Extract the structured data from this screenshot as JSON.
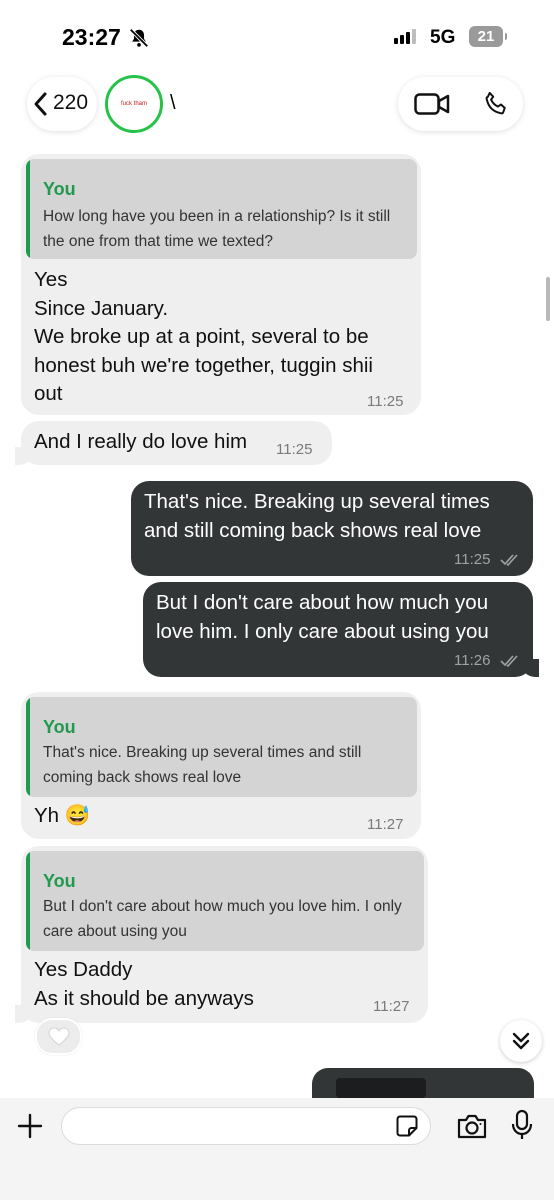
{
  "status_bar": {
    "time": "23:27",
    "network": "5G",
    "battery": "21"
  },
  "header": {
    "back_count": "220",
    "avatar_text": "fuck tham",
    "contact_name": "\\"
  },
  "messages": [
    {
      "direction": "in",
      "quote": {
        "author": "You",
        "text": "How long have you been in a relationship? Is it still the one from that time we texted?"
      },
      "lines": [
        "Yes",
        "Since January.",
        "We broke up at a point, several to be",
        "honest buh we're together, tuggin shii",
        "out"
      ],
      "time": "11:25"
    },
    {
      "direction": "in",
      "lines": [
        "And I really do love him"
      ],
      "time": "11:25"
    },
    {
      "direction": "out",
      "lines": [
        "That's nice. Breaking up several times",
        "and still coming back shows real love"
      ],
      "time": "11:25"
    },
    {
      "direction": "out",
      "lines": [
        "But I don't care about how much you",
        "love him. I only care about using you"
      ],
      "time": "11:26"
    },
    {
      "direction": "in",
      "quote": {
        "author": "You",
        "text": "That's nice. Breaking up several times and still coming back shows real love"
      },
      "lines": [
        "Yh 😅"
      ],
      "time": "11:27"
    },
    {
      "direction": "in",
      "quote": {
        "author": "You",
        "text": "But I don't care about how much you love him. I only care about using you"
      },
      "lines": [
        "Yes Daddy",
        "As it should be anyways"
      ],
      "time": "11:27",
      "reaction": "white-heart"
    }
  ],
  "composer": {
    "placeholder": "",
    "value": ""
  },
  "icons": [
    "bell-slash-icon",
    "signal-icon",
    "back-chevron-icon",
    "video-icon",
    "phone-icon",
    "double-check-icon",
    "white-heart-icon",
    "chevrons-down-icon",
    "plus-icon",
    "sticker-icon",
    "camera-icon",
    "microphone-icon"
  ],
  "colors": {
    "outgoing_bubble": "#333637",
    "incoming_bubble": "#efefef",
    "quote_accent": "#1f9a4e",
    "avatar_ring": "#25c34a"
  }
}
